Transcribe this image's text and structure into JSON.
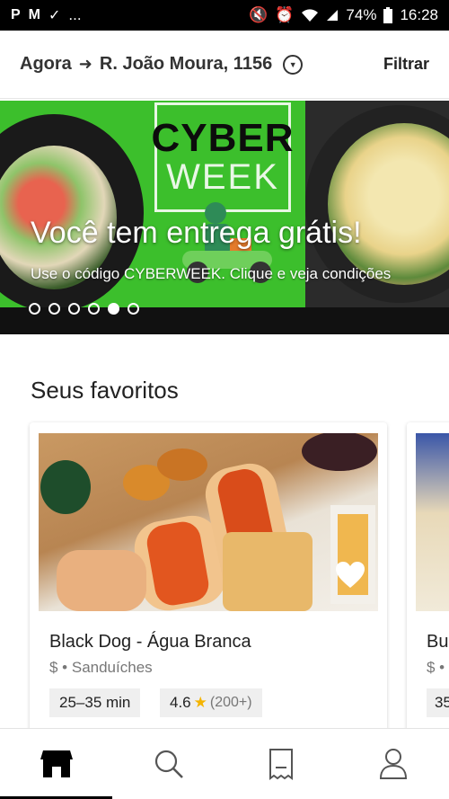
{
  "status_bar": {
    "battery": "74%",
    "time": "16:28",
    "overflow": "..."
  },
  "header": {
    "time_label": "Agora",
    "address": "R. João Moura, 1156",
    "filter_label": "Filtrar"
  },
  "banner": {
    "logo_top": "CYBER",
    "logo_bottom": "WEEK",
    "title": "Você tem entrega grátis!",
    "subtitle": "Use o código CYBERWEEK. Clique e veja condições",
    "dots_total": 6,
    "active_dot": 5
  },
  "favorites": {
    "section_title": "Seus favoritos",
    "cards": [
      {
        "name": "Black Dog - Água Branca",
        "category": "$ • Sanduíches",
        "eta": "25–35 min",
        "rating": "4.6",
        "rating_count": "(200+)"
      },
      {
        "name": "Bu",
        "category": "$ •",
        "eta": "35"
      }
    ]
  },
  "bottom_nav": {
    "items": [
      "home-icon",
      "search-icon",
      "receipt-icon",
      "profile-icon"
    ],
    "active": "home-icon"
  },
  "colors": {
    "banner_green": "#3cbf2c",
    "star": "#f4b400",
    "tag_bg": "#efefef"
  }
}
